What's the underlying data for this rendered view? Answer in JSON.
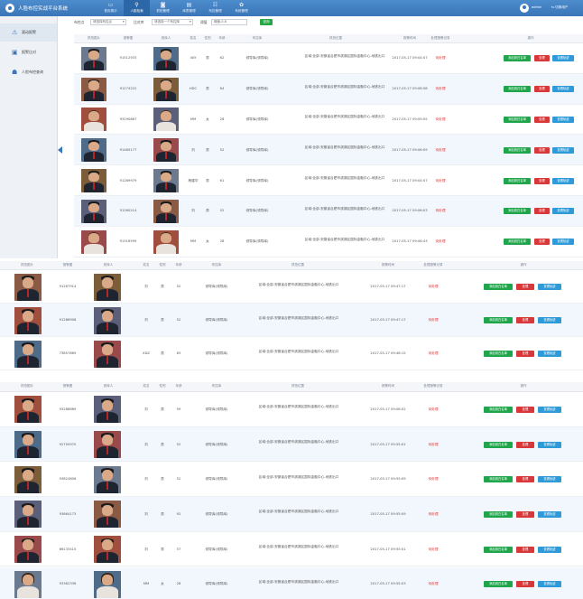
{
  "header": {
    "app_title": "人脸布控实战平台系统",
    "nav": [
      {
        "label": "首页展示",
        "icon": "monitor-icon",
        "glyph": "▭",
        "active": false
      },
      {
        "label": "人脸检索",
        "icon": "search-icon",
        "glyph": "⚲",
        "active": true
      },
      {
        "label": "抓拍管理",
        "icon": "camera-icon",
        "glyph": "◙",
        "active": false
      },
      {
        "label": "库表管理",
        "icon": "database-icon",
        "glyph": "▤",
        "active": false
      },
      {
        "label": "布控管理",
        "icon": "grid-icon",
        "glyph": "☷",
        "active": false
      },
      {
        "label": "系统管理",
        "icon": "gear-icon",
        "glyph": "✿",
        "active": false
      }
    ],
    "user_name": "admin",
    "logout_label": "⇆ 切换用户"
  },
  "sidebar": {
    "items": [
      {
        "label": "滚动报警",
        "icon": "alert-icon",
        "glyph": "⚠",
        "active": true
      },
      {
        "label": "报警比对",
        "icon": "compare-icon",
        "glyph": "▣",
        "active": false
      },
      {
        "label": "人脸布控查询",
        "icon": "people-icon",
        "glyph": "☗",
        "active": false
      }
    ]
  },
  "filters": {
    "camera_label": "布控点",
    "camera_value": "请选择布控点",
    "lib_label": "比对库",
    "lib_value": "请选择一个布控库",
    "threshold_label": "阈值",
    "threshold_value": "阈值-0.8",
    "search_label": "查询"
  },
  "colors": {
    "header": "#3a76b8",
    "active_nav": "#2c67a7",
    "btn_green": "#1fa64a",
    "btn_red": "#d9383a",
    "btn_blue": "#2e9ad8",
    "status_red": "#e0322f"
  },
  "columns": [
    "抓拍图片",
    "报警图",
    "底库人",
    "姓名",
    "性别",
    "年龄",
    "布控库",
    "抓拍位置",
    "报警时间",
    "处理报警记录",
    "操作"
  ],
  "actions": {
    "view": "添加到白名单",
    "handle": "处理",
    "detail": "查看轨迹"
  },
  "address": "区域:全部-安徽省合肥市滨湖区国际金融中心-地铁出口",
  "library": "领导库(领导库)",
  "status": "待处理",
  "tables": [
    {
      "rows": [
        {
          "id": "91512933",
          "name": "VAY",
          "gender": "男",
          "age": "62",
          "time": "2017-05-17 09:04:07"
        },
        {
          "id": "91274222",
          "name": "HDC",
          "gender": "男",
          "age": "64",
          "time": "2017-05-17 09:08:58"
        },
        {
          "id": "93290667",
          "name": "MM",
          "gender": "女",
          "age": "28",
          "time": "2017-05-17 09:09:05"
        },
        {
          "id": "91465177",
          "name": "刘",
          "gender": "男",
          "age": "52",
          "time": "2017-05-17 09:06:09"
        },
        {
          "id": "91289979",
          "name": "杨建华",
          "gender": "男",
          "age": "61",
          "time": "2017-05-17 09:04:07"
        },
        {
          "id": "91260214",
          "name": "刘",
          "gender": "男",
          "age": "52",
          "time": "2017-05-17 09:06:03"
        },
        {
          "id": "91316599",
          "name": "MM",
          "gender": "女",
          "age": "28",
          "time": "2017-05-17 09:06:43"
        }
      ]
    },
    {
      "rows": [
        {
          "id": "91287914",
          "name": "刘",
          "gender": "男",
          "age": "52",
          "time": "2017-05-17 09:47:17"
        },
        {
          "id": "91286908",
          "name": "刘",
          "gender": "男",
          "age": "52",
          "time": "2017-05-17 09:47:17"
        },
        {
          "id": "73857869",
          "name": "XDZ",
          "gender": "男",
          "age": "63",
          "time": "2017-05-17 09:46:15"
        }
      ]
    },
    {
      "rows": [
        {
          "id": "93288889",
          "name": "刘",
          "gender": "男",
          "age": "59",
          "time": "2017-05-17 09:08:02"
        },
        {
          "id": "92750970",
          "name": "刘",
          "gender": "男",
          "age": "52",
          "time": "2017-05-17 09:55:01"
        },
        {
          "id": "93824806",
          "name": "刘",
          "gender": "男",
          "age": "52",
          "time": "2017-05-17 09:55:09"
        },
        {
          "id": "93664173",
          "name": "刘",
          "gender": "男",
          "age": "92",
          "time": "2017-05-17 09:55:09"
        },
        {
          "id": "86133415",
          "name": "刘",
          "gender": "男",
          "age": "57",
          "time": "2017-05-17 09:55:01"
        },
        {
          "id": "93362336",
          "name": "MM",
          "gender": "女",
          "age": "28",
          "time": "2017-05-17 09:55:03"
        }
      ]
    }
  ]
}
